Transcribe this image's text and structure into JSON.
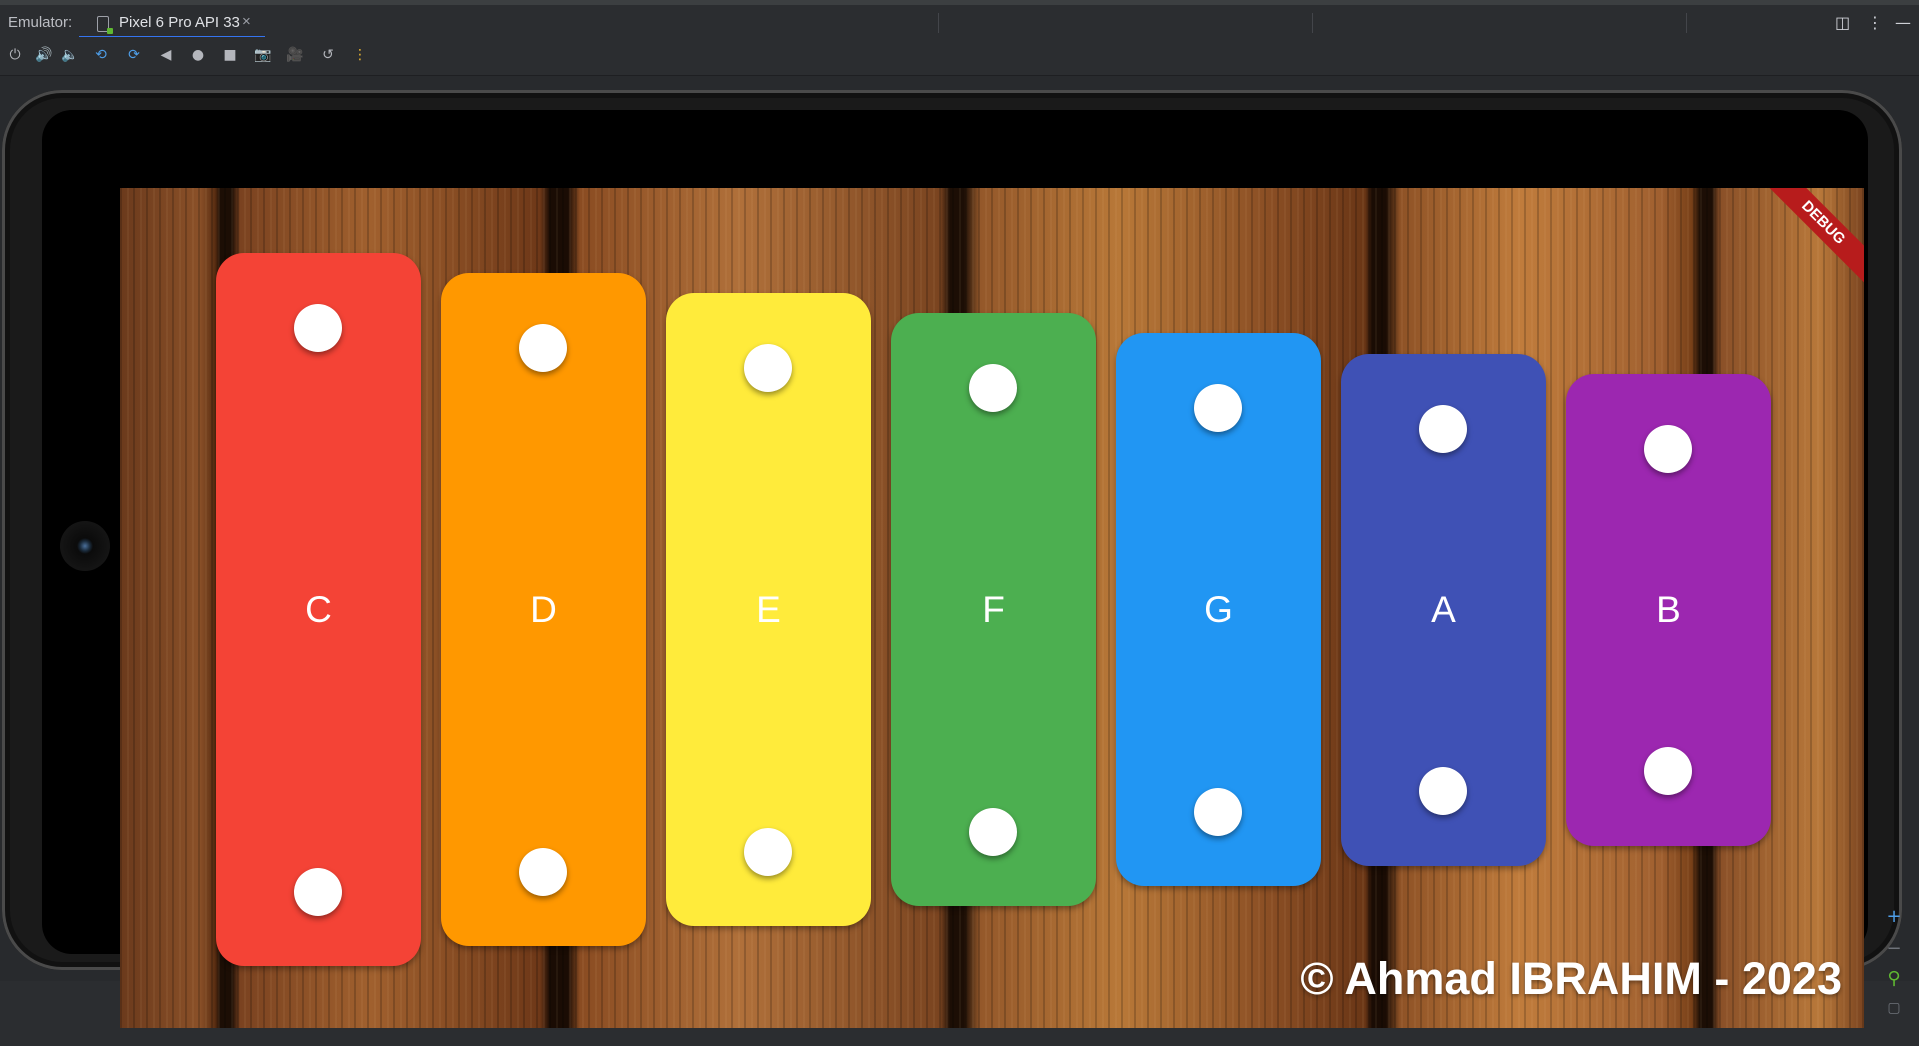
{
  "topbar": {
    "label": "Emulator:",
    "tab_title": "Pixel 6 Pro API 33",
    "tab_close": "×",
    "icons": [
      "panel-layout-icon",
      "more-vertical-icon",
      "minimize-icon"
    ]
  },
  "toolbar": {
    "buttons": [
      "power-icon",
      "volume-up-icon",
      "volume-down-icon",
      "rotate-left-icon",
      "rotate-right-icon",
      "back-icon",
      "home-icon",
      "overview-icon",
      "screenshot-icon",
      "screen-record-icon",
      "snapshot-icon",
      "more-icon"
    ]
  },
  "app": {
    "debug_banner": "DEBUG",
    "copyright": "© Ahmad IBRAHIM - 2023",
    "bars": [
      {
        "note": "C",
        "color": "#f44336"
      },
      {
        "note": "D",
        "color": "#ff9800"
      },
      {
        "note": "E",
        "color": "#ffeb3b"
      },
      {
        "note": "F",
        "color": "#4caf50"
      },
      {
        "note": "G",
        "color": "#2196f3"
      },
      {
        "note": "A",
        "color": "#3f51b5"
      },
      {
        "note": "B",
        "color": "#9c27b0"
      }
    ]
  },
  "zoom": {
    "zoom_in": "+",
    "zoom_out": "−"
  }
}
